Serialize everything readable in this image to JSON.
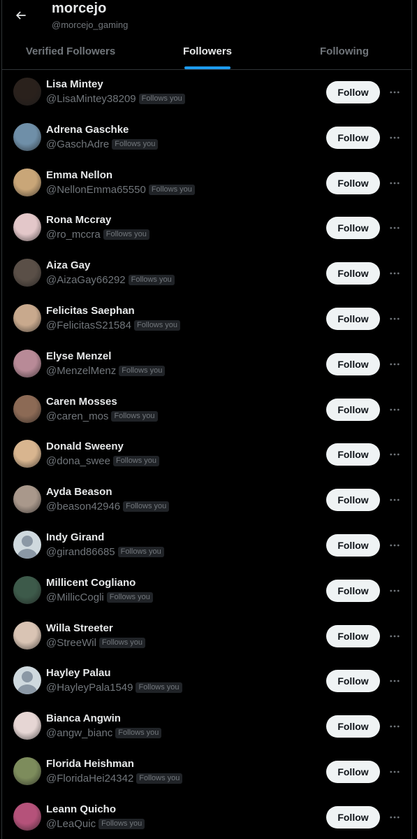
{
  "header": {
    "title": "morcejo",
    "handle": "@morcejo_gaming",
    "back_icon": "arrow-left-icon"
  },
  "tabs": [
    {
      "label": "Verified Followers",
      "active": false
    },
    {
      "label": "Followers",
      "active": true
    },
    {
      "label": "Following",
      "active": false
    }
  ],
  "colors": {
    "background": "#000000",
    "accent": "#1d9bf0",
    "text_primary": "#e7e9ea",
    "text_secondary": "#71767b",
    "button_bg": "#eff3f4",
    "border": "#2f3336"
  },
  "users": [
    {
      "name": "Lisa Mintey",
      "handle": "@LisaMintey38209",
      "badge": "Follows you",
      "button": "Follow",
      "avatar": "photo",
      "avatar_color": "#2a211c"
    },
    {
      "name": "Adrena Gaschke",
      "handle": "@GaschAdre",
      "badge": "Follows you",
      "button": "Follow",
      "avatar": "photo",
      "avatar_color": "#6f8fa8"
    },
    {
      "name": "Emma Nellon",
      "handle": "@NellonEmma65550",
      "badge": "Follows you",
      "button": "Follow",
      "avatar": "photo",
      "avatar_color": "#c9a678"
    },
    {
      "name": "Rona Mccray",
      "handle": "@ro_mccra",
      "badge": "Follows you",
      "button": "Follow",
      "avatar": "photo",
      "avatar_color": "#e3c7c9"
    },
    {
      "name": "Aiza Gay",
      "handle": "@AizaGay66292",
      "badge": "Follows you",
      "button": "Follow",
      "avatar": "photo",
      "avatar_color": "#5a4f47"
    },
    {
      "name": "Felicitas Saephan",
      "handle": "@FelicitasS21584",
      "badge": "Follows you",
      "button": "Follow",
      "avatar": "photo",
      "avatar_color": "#c8a98d"
    },
    {
      "name": "Elyse Menzel",
      "handle": "@MenzelMenz",
      "badge": "Follows you",
      "button": "Follow",
      "avatar": "photo",
      "avatar_color": "#b88a97"
    },
    {
      "name": "Caren Mosses",
      "handle": "@caren_mos",
      "badge": "Follows you",
      "button": "Follow",
      "avatar": "photo",
      "avatar_color": "#8c6a55"
    },
    {
      "name": "Donald Sweeny",
      "handle": "@dona_swee",
      "badge": "Follows you",
      "button": "Follow",
      "avatar": "photo",
      "avatar_color": "#d8b58f"
    },
    {
      "name": "Ayda Beason",
      "handle": "@beason42946",
      "badge": "Follows you",
      "button": "Follow",
      "avatar": "photo",
      "avatar_color": "#a9988b"
    },
    {
      "name": "Indy Girand",
      "handle": "@girand86685",
      "badge": "Follows you",
      "button": "Follow",
      "avatar": "default",
      "avatar_color": "#cfd9de"
    },
    {
      "name": "Millicent Cogliano",
      "handle": "@MillicCogli",
      "badge": "Follows you",
      "button": "Follow",
      "avatar": "photo",
      "avatar_color": "#3d5a4a"
    },
    {
      "name": "Willa Streeter",
      "handle": "@StreeWil",
      "badge": "Follows you",
      "button": "Follow",
      "avatar": "photo",
      "avatar_color": "#d9c4b4"
    },
    {
      "name": "Hayley Palau",
      "handle": "@HayleyPala1549",
      "badge": "Follows you",
      "button": "Follow",
      "avatar": "default",
      "avatar_color": "#cfd9de"
    },
    {
      "name": "Bianca Angwin",
      "handle": "@angw_bianc",
      "badge": "Follows you",
      "button": "Follow",
      "avatar": "photo",
      "avatar_color": "#e6d6d4"
    },
    {
      "name": "Florida Heishman",
      "handle": "@FloridaHei24342",
      "badge": "Follows you",
      "button": "Follow",
      "avatar": "photo",
      "avatar_color": "#7d8c5c"
    },
    {
      "name": "Leann Quicho",
      "handle": "@LeaQuic",
      "badge": "Follows you",
      "button": "Follow",
      "avatar": "photo",
      "avatar_color": "#b5527a"
    }
  ]
}
